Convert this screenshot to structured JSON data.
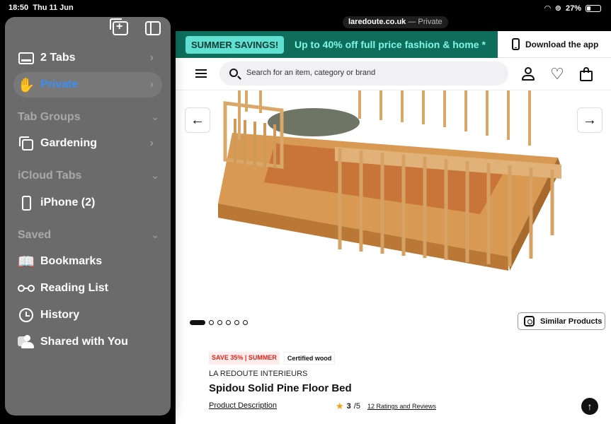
{
  "status_bar": {
    "time": "18:50",
    "date": "Thu 11 Jun",
    "battery": "27%",
    "battery_level": 0.27
  },
  "address_bar": {
    "domain": "laredoute.co.uk",
    "mode": "— Private"
  },
  "sidebar": {
    "top_icons": [
      "new-tab-group-icon",
      "sidebar-toggle-icon"
    ],
    "rows": [
      {
        "label": "2 Tabs",
        "icon": "tabs-icon"
      },
      {
        "label": "Private",
        "icon": "hand-icon",
        "selected": true
      }
    ],
    "tab_groups": {
      "header": "Tab Groups",
      "items": [
        {
          "label": "Gardening",
          "icon": "tab-group-icon"
        }
      ]
    },
    "icloud": {
      "header": "iCloud Tabs",
      "items": [
        {
          "label": "iPhone (2)",
          "icon": "iphone-icon"
        }
      ]
    },
    "saved": {
      "header": "Saved",
      "items": [
        {
          "label": "Bookmarks",
          "icon": "book-icon"
        },
        {
          "label": "Reading List",
          "icon": "glasses-icon"
        },
        {
          "label": "History",
          "icon": "clock-icon"
        },
        {
          "label": "Shared with You",
          "icon": "shared-icon"
        }
      ]
    }
  },
  "page": {
    "promo": {
      "tag": "SUMMER SAVINGS!",
      "text": "Up to 40% off full price fashion & home *",
      "download": "Download the app"
    },
    "search": {
      "placeholder": "Search for an item, category or brand"
    },
    "gallery": {
      "prev": "←",
      "next": "→",
      "dots_total": 6,
      "active_dot": 0,
      "similar": "Similar Products"
    },
    "product": {
      "badge_sale": "SAVE 35% | SUMMER",
      "badge_cert": "Certified wood",
      "brand": "LA REDOUTE INTERIEURS",
      "title": "Spidou Solid Pine Floor Bed",
      "desc_link": "Product Description",
      "rating": "3",
      "rating_max": "/5",
      "reviews": "12 Ratings and Reviews"
    },
    "back_to_top": "↑"
  },
  "colors": {
    "promo_bg": "#0e6e5b",
    "promo_tag": "#5fe0d1",
    "promo_text": "#7ff5e3",
    "private_blue": "#3a8ef6",
    "sale_red": "#e1251b",
    "wood": "#c98a45"
  }
}
